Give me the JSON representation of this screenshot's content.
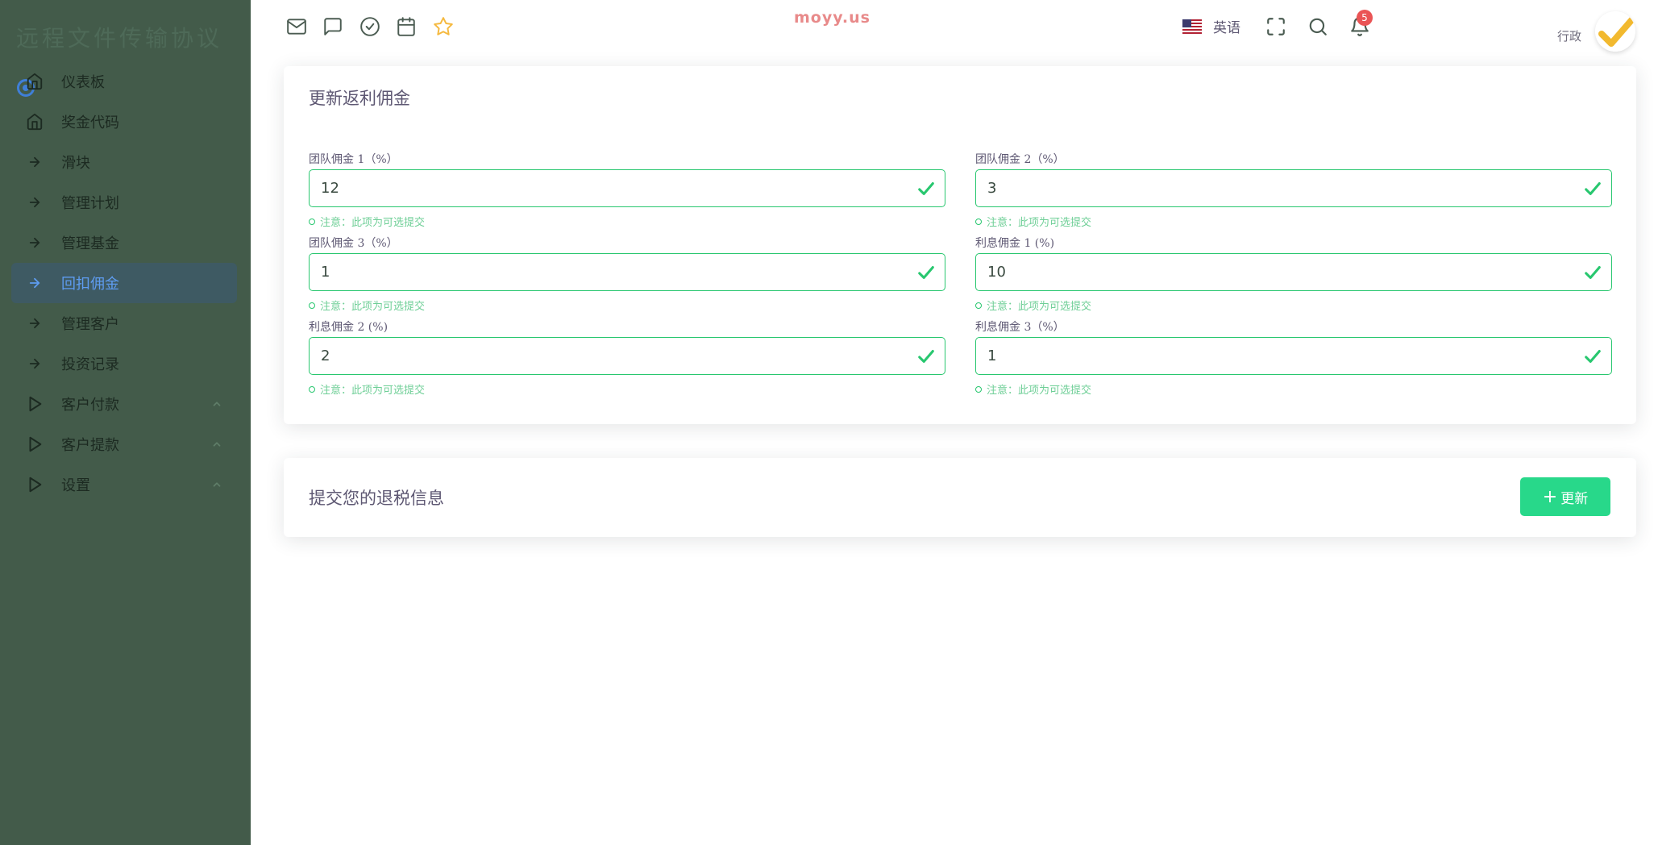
{
  "sidebar": {
    "brand": "远程文件传输协议",
    "items": [
      {
        "label": "仪表板",
        "icon": "home-icon",
        "active": false,
        "chevron": false
      },
      {
        "label": "奖金代码",
        "icon": "home-icon",
        "active": false,
        "chevron": false
      },
      {
        "label": "滑块",
        "icon": "arrow-right-icon",
        "active": false,
        "chevron": false
      },
      {
        "label": "管理计划",
        "icon": "arrow-right-icon",
        "active": false,
        "chevron": false
      },
      {
        "label": "管理基金",
        "icon": "arrow-right-icon",
        "active": false,
        "chevron": false
      },
      {
        "label": "回扣佣金",
        "icon": "arrow-right-icon",
        "active": true,
        "chevron": false
      },
      {
        "label": "管理客户",
        "icon": "arrow-right-icon",
        "active": false,
        "chevron": false
      },
      {
        "label": "投资记录",
        "icon": "arrow-right-icon",
        "active": false,
        "chevron": false
      },
      {
        "label": "客户付款",
        "icon": "play-icon",
        "active": false,
        "chevron": true
      },
      {
        "label": "客户提款",
        "icon": "play-icon",
        "active": false,
        "chevron": true
      },
      {
        "label": "设置",
        "icon": "play-icon",
        "active": false,
        "chevron": true
      }
    ]
  },
  "topbar": {
    "watermark": "moyy.us",
    "language": "英语",
    "notification_count": "5",
    "user_role": "行政"
  },
  "form": {
    "title": "更新返利佣金",
    "hint": "注意：此项为可选提交",
    "fields": [
      {
        "label": "团队佣金 1（%）",
        "value": "12"
      },
      {
        "label": "团队佣金 2（%）",
        "value": "3"
      },
      {
        "label": "团队佣金 3（%）",
        "value": "1"
      },
      {
        "label": "利息佣金 1 (%)",
        "value": "10"
      },
      {
        "label": "利息佣金 2 (%)",
        "value": "2"
      },
      {
        "label": "利息佣金 3（%）",
        "value": "1"
      }
    ]
  },
  "submit": {
    "title": "提交您的退税信息",
    "button_label": "更新"
  },
  "colors": {
    "sidebar_bg": "#435b4a",
    "active_item_bg": "#3e5a63",
    "accent_blue": "#5e9cf0",
    "success_green": "#28c76f",
    "button_green": "#28d88a",
    "badge_red": "#ea5455",
    "star_yellow": "#f5b93f"
  }
}
